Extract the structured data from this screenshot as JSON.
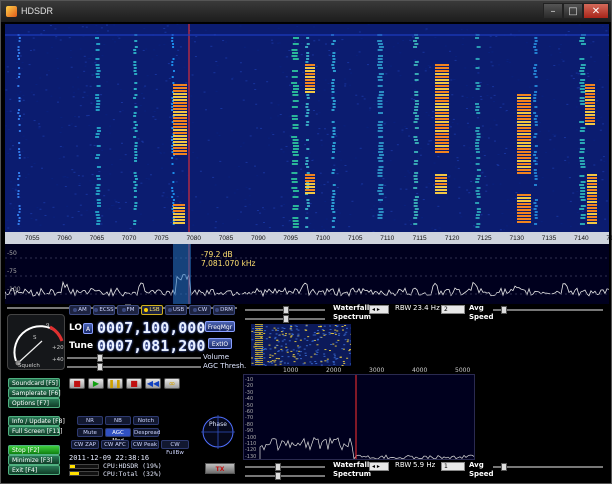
{
  "window": {
    "title": "HDSDR"
  },
  "freq_axis": {
    "ticks": [
      "7055",
      "7060",
      "7065",
      "7070",
      "7075",
      "7080",
      "7085",
      "7090",
      "7095",
      "7100",
      "7105",
      "7110",
      "7115",
      "7120",
      "7125",
      "7130",
      "7135",
      "7140",
      "7145"
    ]
  },
  "spectrum": {
    "y_labels": [
      "-50",
      "-75",
      "-100"
    ],
    "readout_db": "-79.2 dB",
    "readout_freq": "7,081.070 kHz"
  },
  "smeter": {
    "label_s": "S",
    "label_squelch": "Squelch",
    "label_scale": "+40",
    "label_scale2": "+20",
    "label_9": "9"
  },
  "modes": [
    "AM",
    "ECSS",
    "FM",
    "LSB",
    "USB",
    "CW",
    "DRM"
  ],
  "active_mode": "LSB",
  "lo": {
    "label": "LO",
    "marker": "A",
    "value": "0007,100,000"
  },
  "tune": {
    "label": "Tune",
    "value": "0007,081,200"
  },
  "buttons": {
    "freqmgr": "FreqMgr",
    "extio": "ExtIO",
    "volume": "Volume",
    "agc_thresh": "AGC Thresh.",
    "tx": "TX"
  },
  "side_buttons": [
    {
      "label": "Soundcard  [F5]"
    },
    {
      "label": "Samplerate [F6]"
    },
    {
      "label": "Options     [F7]"
    },
    {
      "label": "Info / Update [F8]"
    },
    {
      "label": "Full Screen [F11]"
    },
    {
      "label": "Stop        [F2]"
    },
    {
      "label": "Minimize   [F3]"
    },
    {
      "label": "Exit         [F4]"
    }
  ],
  "transport": [
    "■",
    "▶",
    "❚❚",
    "■",
    "◀◀",
    "∞"
  ],
  "nr_buttons": [
    {
      "label": "NR",
      "on": false
    },
    {
      "label": "NB",
      "on": false
    },
    {
      "label": "Notch",
      "on": false
    },
    {
      "label": "Mute",
      "on": false
    },
    {
      "label": "AGC Med",
      "on": true
    },
    {
      "label": "Despread",
      "on": false
    },
    {
      "label": "CW ZAP",
      "on": false
    },
    {
      "label": "CW AFC",
      "on": false
    },
    {
      "label": "CW Peak",
      "on": false
    },
    {
      "label": "CW FullBw",
      "on": false
    }
  ],
  "phase_label": "Phase",
  "status": {
    "datetime": "2011-12-09 22:38:16",
    "cpu_hdsdr": "CPU:HDSDR  (19%)",
    "cpu_total": "CPU:Total   (32%)"
  },
  "rf_panel": {
    "waterfall": "Waterfall",
    "spectrum": "Spectrum",
    "rbw_label": "RBW",
    "rbw_value": "23.4 Hz",
    "avg_select": "2",
    "avg": "Avg",
    "speed": "Speed"
  },
  "af_panel": {
    "waterfall": "Waterfall",
    "spectrum": "Spectrum",
    "rbw_label": "RBW",
    "rbw_value": "5.9 Hz",
    "avg_select": "1",
    "avg": "Avg",
    "speed": "Speed",
    "x_ticks": [
      "1000",
      "2000",
      "3000",
      "4000",
      "5000"
    ],
    "y_labels": [
      "-10",
      "-20",
      "-30",
      "-40",
      "-50",
      "-60",
      "-70",
      "-80",
      "-90",
      "-100",
      "-110",
      "-120",
      "-130"
    ]
  },
  "colors": {
    "accent": "#ffd000",
    "waterfall_bg": "#0a1a6a",
    "tune_marker": "#ff3030"
  }
}
